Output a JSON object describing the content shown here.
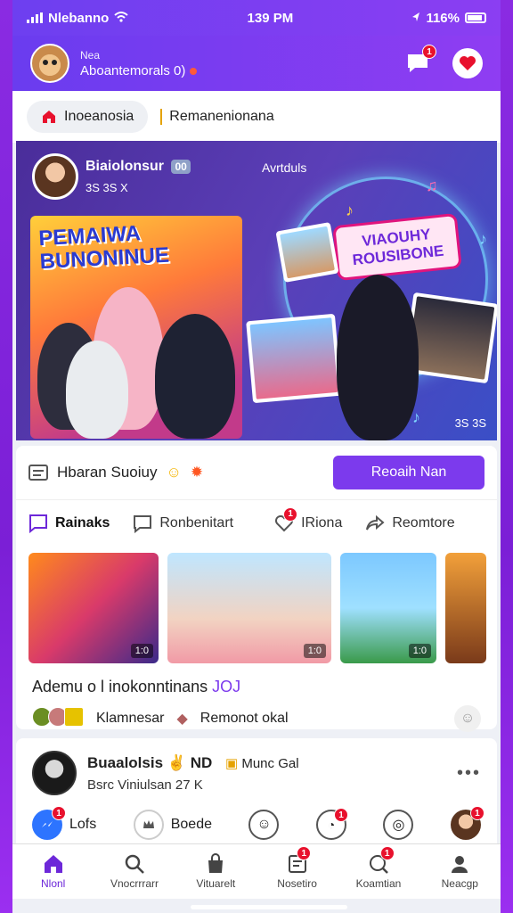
{
  "status_bar": {
    "carrier": "Nlebanno",
    "time": "139 PM",
    "battery_text": "116%"
  },
  "header": {
    "line1": "Nea",
    "line2": "Aboantemorals 0)",
    "chat_badge": "1"
  },
  "tabs": {
    "active": "Inoeanosia",
    "second": "Remanenionana"
  },
  "hero": {
    "host_name": "Biaiolonsur",
    "host_badge": "00",
    "host_sub": "3S 3S X",
    "top_right_label": "Avrtduls",
    "poster_left_title": "PEMAIWA BUNONINUE",
    "poster_right_title": "VIAOUHY ROUSIBONE",
    "counter": "3S 3S"
  },
  "search_row": {
    "label": "Hbaran Suoiuy",
    "button": "Reoaih Nan"
  },
  "actions": [
    {
      "label": "Rainaks",
      "badge": ""
    },
    {
      "label": "Ronbenitart",
      "badge": ""
    },
    {
      "label": "IRiona",
      "badge": "1"
    },
    {
      "label": "Reomtore",
      "badge": ""
    }
  ],
  "thumbs": [
    {
      "duration": "1:0"
    },
    {
      "duration": "1:0"
    },
    {
      "duration": "1:0"
    },
    {
      "duration": ""
    }
  ],
  "caption": {
    "text": "Ademu o l inokonntinans",
    "highlight": "JOJ"
  },
  "meta": {
    "left": "Klamnesar",
    "right": "Remonot okal"
  },
  "post": {
    "name": "Buaalolsis",
    "name_tag": "ND",
    "tag2": "Munc Gal",
    "sub": "Bsrc Viniulsan 27 K"
  },
  "reactions": {
    "first_label": "Lofs",
    "second_label": "Boede"
  },
  "nav": [
    {
      "label": "Nlonl",
      "icon": "home-icon"
    },
    {
      "label": "Vnocrrrarr",
      "icon": "search-icon"
    },
    {
      "label": "Vituarelt",
      "icon": "bag-icon"
    },
    {
      "label": "Nosetiro",
      "icon": "news-icon"
    },
    {
      "label": "Koamtian",
      "icon": "chat-search-icon"
    },
    {
      "label": "Neacgp",
      "icon": "profile-icon"
    }
  ],
  "colors": {
    "accent": "#7c3aed",
    "badge": "#e8112d",
    "header": "#6a3cef"
  }
}
